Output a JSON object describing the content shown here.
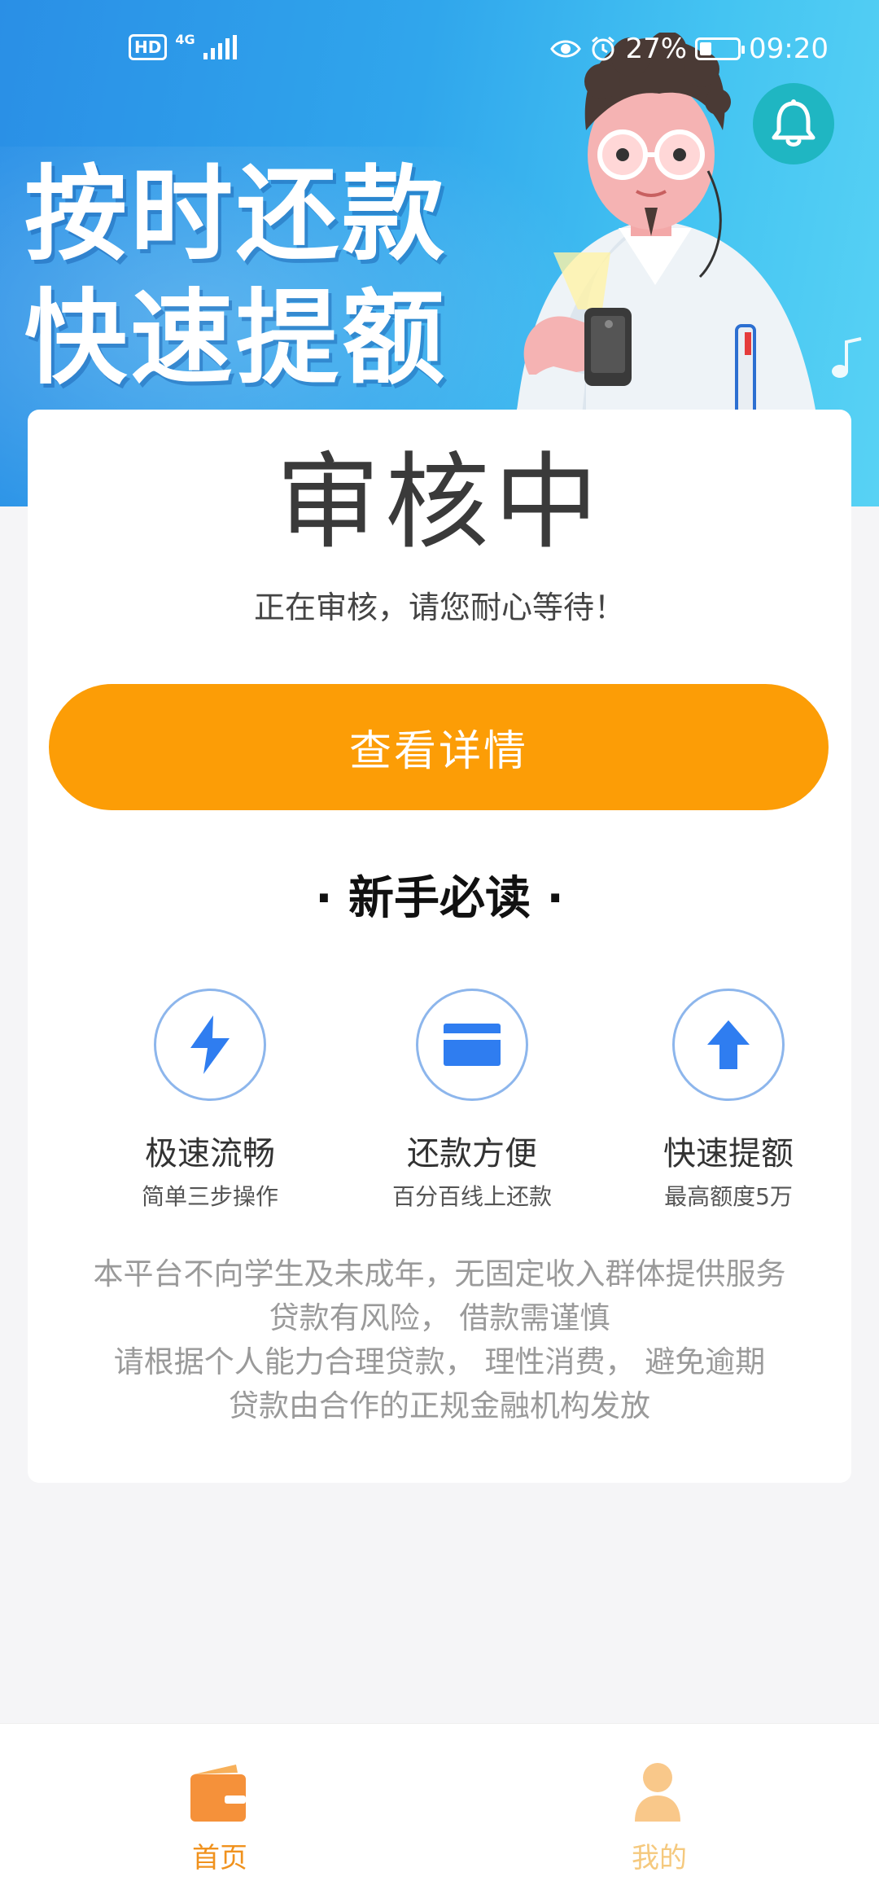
{
  "status_bar": {
    "hd": "HD",
    "network": "4G",
    "battery_percent": "27%",
    "time": "09:20"
  },
  "banner": {
    "slogan_line1": "按时还款",
    "slogan_line2": "快速提额",
    "bell_icon": "bell-icon"
  },
  "status_card": {
    "title": "审核中",
    "description": "正在审核，请您耐心等待！",
    "detail_button": "查看详情"
  },
  "guide": {
    "title": "· 新手必读 ·",
    "features": [
      {
        "icon": "lightning-icon",
        "title": "极速流畅",
        "subtitle": "简单三步操作"
      },
      {
        "icon": "card-icon",
        "title": "还款方便",
        "subtitle": "百分百线上还款"
      },
      {
        "icon": "arrow-up-icon",
        "title": "快速提额",
        "subtitle": "最高额度5万"
      }
    ]
  },
  "notice_lines": [
    "本平台不向学生及未成年，无固定收入群体提供服务",
    "贷款有风险， 借款需谨慎",
    "请根据个人能力合理贷款， 理性消费， 避免逾期",
    "贷款由合作的正规金融机构发放"
  ],
  "bottom_nav": {
    "items": [
      {
        "label": "首页",
        "icon": "wallet-icon",
        "active": true
      },
      {
        "label": "我的",
        "icon": "person-icon",
        "active": false
      }
    ]
  },
  "colors": {
    "accent": "#fc9d06",
    "nav_active": "#f0921e",
    "nav_inactive": "#f5c97e",
    "feature_icon": "#2f7df0",
    "bell_bg": "#1fb6c2"
  }
}
